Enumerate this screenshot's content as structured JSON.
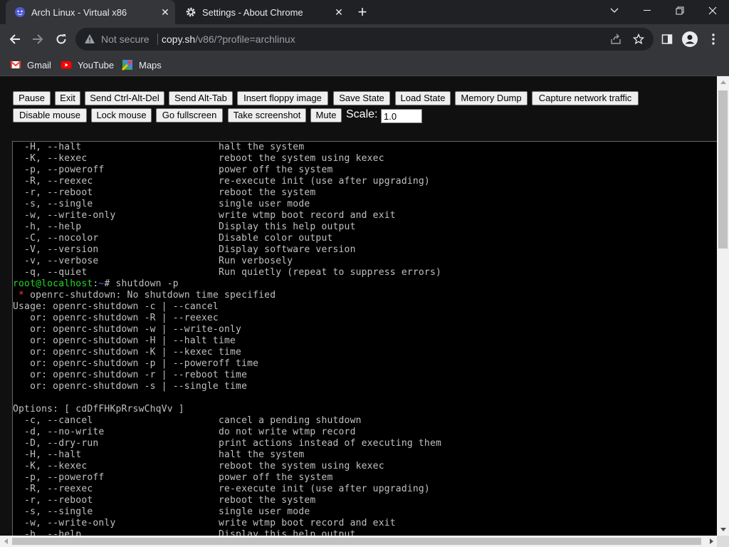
{
  "browser": {
    "tabs": [
      {
        "title": "Arch Linux - Virtual x86",
        "active": true,
        "icon": "v86-icon"
      },
      {
        "title": "Settings - About Chrome",
        "active": false,
        "icon": "gear-icon"
      }
    ],
    "new_tab_label": "+",
    "address": {
      "security_label": "Not secure",
      "host": "copy.sh",
      "path": "/v86/?profile=archlinux"
    },
    "bookmarks": [
      {
        "label": "Gmail",
        "icon": "gmail-icon"
      },
      {
        "label": "YouTube",
        "icon": "youtube-icon"
      },
      {
        "label": "Maps",
        "icon": "maps-icon"
      }
    ]
  },
  "controls": {
    "row1": [
      "Pause",
      "Exit",
      "Send Ctrl-Alt-Del",
      "Send Alt-Tab",
      "Insert floppy image",
      "Save State",
      "Load State",
      "Memory Dump",
      "Capture network traffic"
    ],
    "row2": [
      "Disable mouse",
      "Lock mouse",
      "Go fullscreen",
      "Take screenshot",
      "Mute"
    ],
    "scale_label": "Scale:",
    "scale_value": "1.0"
  },
  "terminal": {
    "lines": [
      "  -H, --halt                        halt the system",
      "  -K, --kexec                       reboot the system using kexec",
      "  -p, --poweroff                    power off the system",
      "  -R, --reexec                      re-execute init (use after upgrading)",
      "  -r, --reboot                      reboot the system",
      "  -s, --single                      single user mode",
      "  -w, --write-only                  write wtmp boot record and exit",
      "  -h, --help                        Display this help output",
      "  -C, --nocolor                     Disable color output",
      "  -V, --version                     Display software version",
      "  -v, --verbose                     Run verbosely",
      "  -q, --quiet                       Run quietly (repeat to suppress errors)",
      "",
      "",
      "Usage: openrc-shutdown -c | --cancel",
      "   or: openrc-shutdown -R | --reexec",
      "   or: openrc-shutdown -w | --write-only",
      "   or: openrc-shutdown -H | --halt time",
      "   or: openrc-shutdown -K | --kexec time",
      "   or: openrc-shutdown -p | --poweroff time",
      "   or: openrc-shutdown -r | --reboot time",
      "   or: openrc-shutdown -s | --single time",
      "",
      "Options: [ cdDfFHKpRrswChqVv ]",
      "  -c, --cancel                      cancel a pending shutdown",
      "  -d, --no-write                    do not write wtmp record",
      "  -D, --dry-run                     print actions instead of executing them",
      "  -H, --halt                        halt the system",
      "  -K, --kexec                       reboot the system using kexec",
      "  -p, --poweroff                    power off the system",
      "  -R, --reexec                      re-execute init (use after upgrading)",
      "  -r, --reboot                      reboot the system",
      "  -s, --single                      single user mode",
      "  -w, --write-only                  write wtmp boot record and exit",
      "  -h, --help                        Display this help output"
    ],
    "prompt": {
      "user_host": "root@localhost",
      "colon": ":",
      "dir": "~",
      "symbol": "# ",
      "command": "shutdown -p"
    },
    "error": {
      "star": " * ",
      "text": "openrc-shutdown: No shutdown time specified"
    }
  },
  "colors": {
    "prompt_user": "#23d923",
    "prompt_dir": "#5c5cff",
    "error_star": "#ff3b3b"
  }
}
